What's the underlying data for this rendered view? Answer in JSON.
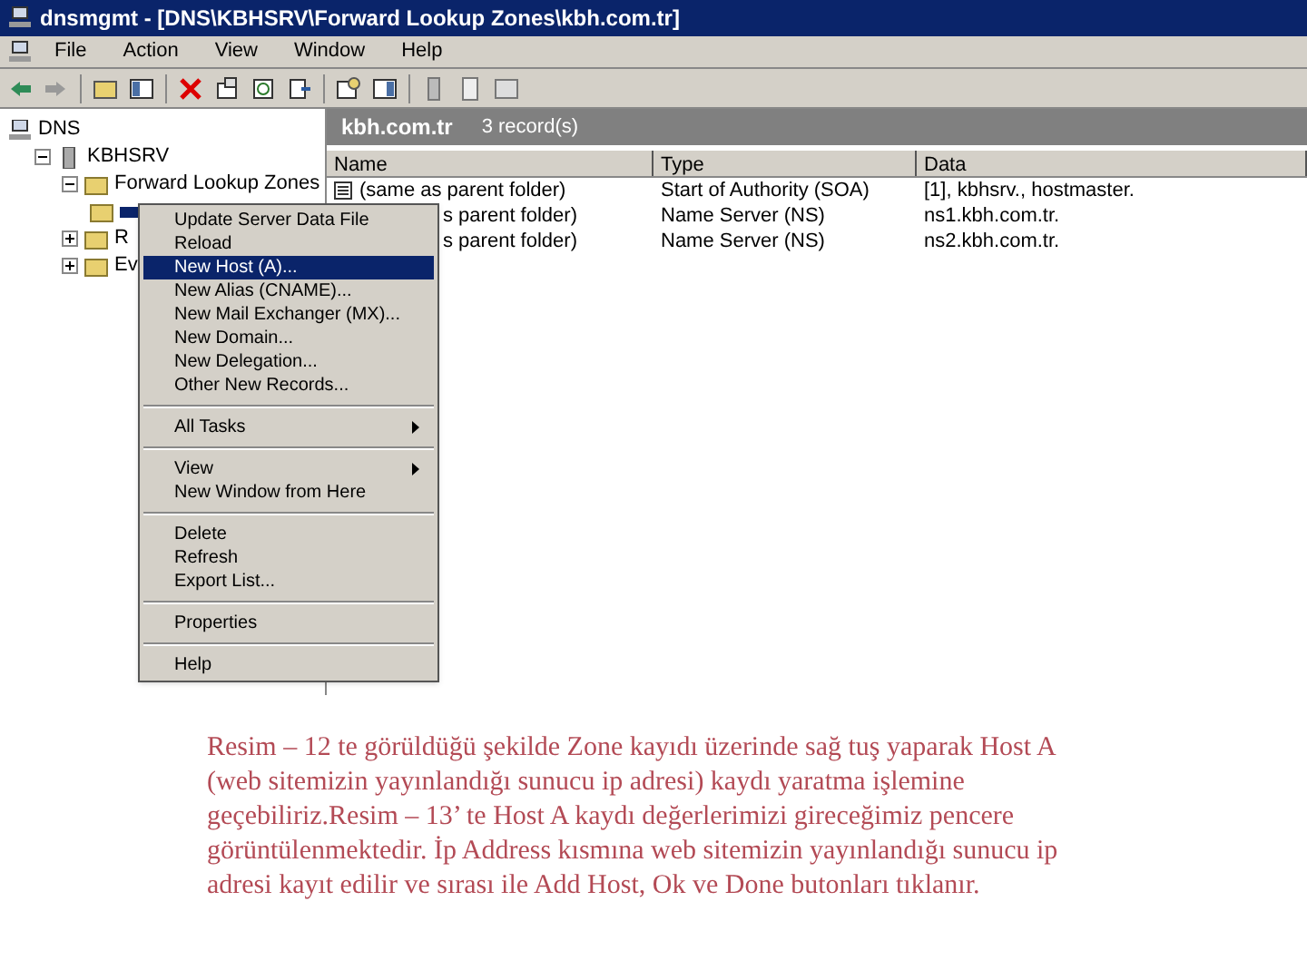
{
  "window": {
    "title": "dnsmgmt - [DNS\\KBHSRV\\Forward Lookup Zones\\kbh.com.tr]"
  },
  "menu_bar": [
    "File",
    "Action",
    "View",
    "Window",
    "Help"
  ],
  "tree": [
    {
      "label": "DNS",
      "children": [
        {
          "label": "KBHSRV",
          "expanded": true,
          "children": [
            {
              "label": "Forward Lookup Zones",
              "expanded": true,
              "children": [
                {
                  "selected": true
                }
              ]
            },
            {
              "label": "R",
              "expanded": false
            },
            {
              "label": "Ev",
              "expanded": false
            }
          ]
        }
      ]
    }
  ],
  "details": {
    "title": "kbh.com.tr",
    "count": "3 record(s)",
    "columns": [
      "Name",
      "Type",
      "Data"
    ],
    "rows": [
      [
        "(same as parent folder)",
        "Start of Authority (SOA)",
        "[1], kbhsrv., hostmaster."
      ],
      [
        "s parent folder)",
        "Name Server (NS)",
        "ns1.kbh.com.tr."
      ],
      [
        "s parent folder)",
        "Name Server (NS)",
        "ns2.kbh.com.tr."
      ]
    ]
  },
  "context_menu": [
    {
      "kind": "item",
      "label": "Update Server Data File",
      "selected": false
    },
    {
      "kind": "item",
      "label": "Reload",
      "selected": false
    },
    {
      "kind": "item",
      "label": "New Host (A)...",
      "selected": true
    },
    {
      "kind": "item",
      "label": "New Alias (CNAME)...",
      "selected": false
    },
    {
      "kind": "item",
      "label": "New Mail Exchanger (MX)...",
      "selected": false
    },
    {
      "kind": "item",
      "label": "New Domain...",
      "selected": false
    },
    {
      "kind": "item",
      "label": "New Delegation...",
      "selected": false
    },
    {
      "kind": "item",
      "label": "Other New Records...",
      "selected": false
    },
    {
      "kind": "separator"
    },
    {
      "kind": "submenu",
      "label": "All Tasks",
      "selected": false
    },
    {
      "kind": "separator"
    },
    {
      "kind": "submenu",
      "label": "View",
      "selected": false
    },
    {
      "kind": "item",
      "label": "New Window from Here",
      "selected": false
    },
    {
      "kind": "separator"
    },
    {
      "kind": "item",
      "label": "Delete",
      "selected": false
    },
    {
      "kind": "item",
      "label": "Refresh",
      "selected": false
    },
    {
      "kind": "item",
      "label": "Export List...",
      "selected": false
    },
    {
      "kind": "separator"
    },
    {
      "kind": "item",
      "label": "Properties",
      "selected": false
    },
    {
      "kind": "separator"
    },
    {
      "kind": "item",
      "label": "Help",
      "selected": false
    }
  ],
  "caption": " Resim – 12 te görüldüğü şekilde Zone kayıdı üzerinde sağ tuş yaparak Host A (web sitemizin yayınlandığı sunucu ip adresi) kaydı yaratma işlemine geçebiliriz.Resim – 13’ te Host A kaydı değerlerimizi gireceğimiz pencere görüntülenmektedir. İp Address kısmına web sitemizin yayınlandığı sunucu ip adresi kayıt edilir ve sırası ile Add Host, Ok ve Done butonları tıklanır."
}
